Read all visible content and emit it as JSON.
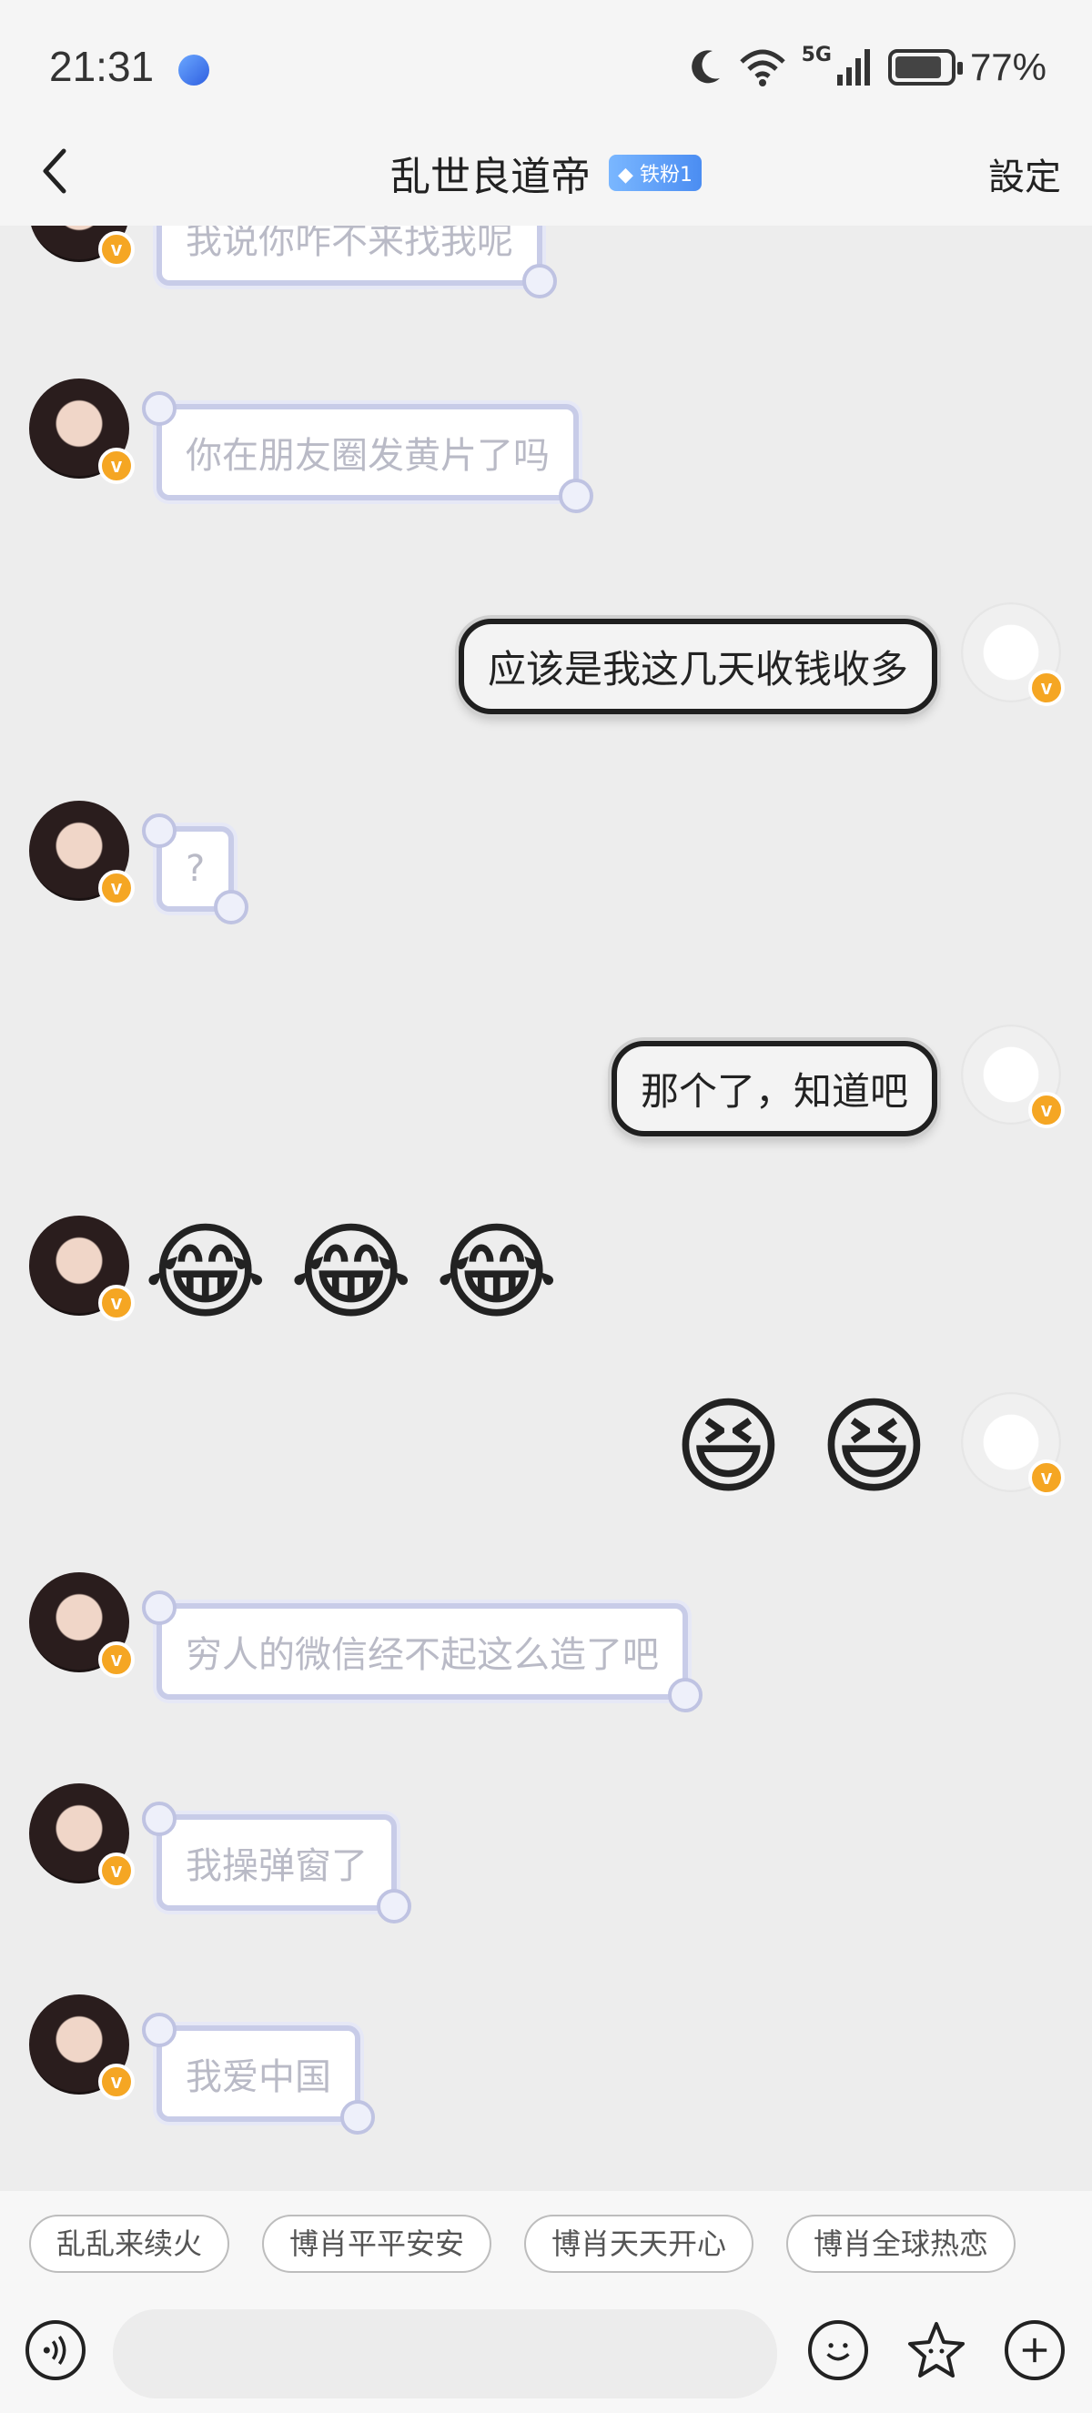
{
  "status": {
    "time": "21:31",
    "network": "5G",
    "battery": "77%"
  },
  "header": {
    "title": "乱世良道帝",
    "badge": "铁粉1",
    "settings": "設定"
  },
  "messages": [
    {
      "side": "left",
      "text": "我说你咋不来找我呢"
    },
    {
      "side": "left",
      "text": "你在朋友圈发黄片了吗"
    },
    {
      "side": "right",
      "text": "应该是我这几天收钱收多"
    },
    {
      "side": "left",
      "text": "?"
    },
    {
      "side": "right",
      "text": "那个了，知道吧"
    },
    {
      "side": "left",
      "emoji": [
        "😂",
        "😂",
        "😂"
      ]
    },
    {
      "side": "right",
      "emoji": [
        "😆",
        "😆"
      ]
    },
    {
      "side": "left",
      "text": "穷人的微信经不起这么造了吧"
    },
    {
      "side": "left",
      "text": "我操弹窗了"
    },
    {
      "side": "left",
      "text": "我爱中国"
    }
  ],
  "quick_replies": [
    "乱乱来续火",
    "博肖平平安安",
    "博肖天天开心",
    "博肖全球热恋"
  ],
  "input": {
    "placeholder": ""
  },
  "colors": {
    "background": "#ededed",
    "verified_badge": "#f5a623",
    "fan_badge": "#4b8df2"
  }
}
